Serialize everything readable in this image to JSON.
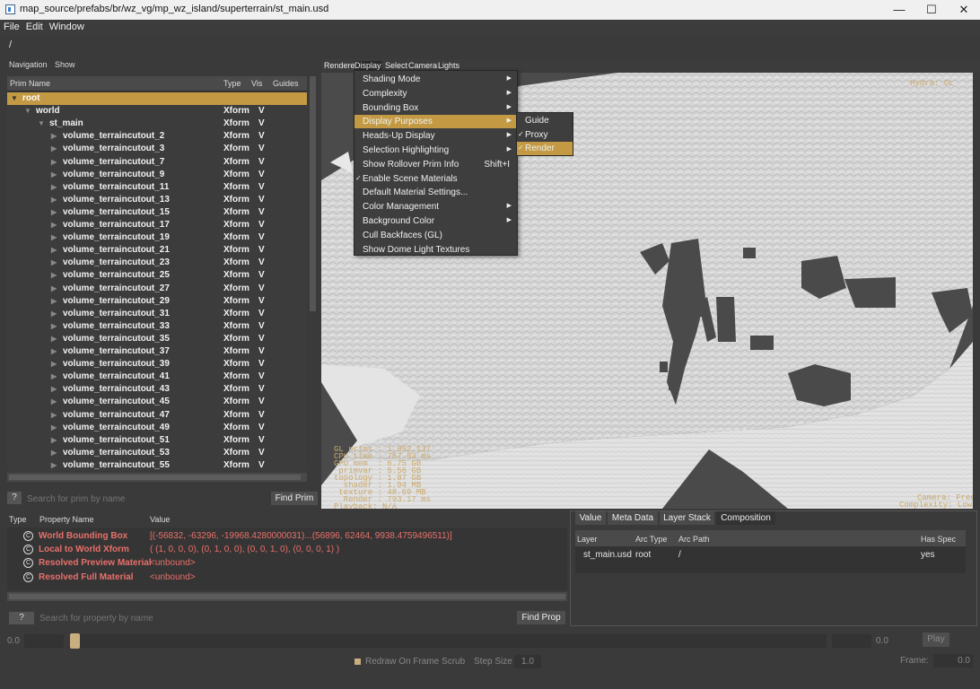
{
  "window": {
    "title": "map_source/prefabs/br/wz_vg/mp_wz_island/superterrain/st_main.usd",
    "minimize": "—",
    "maximize": "☐",
    "close": "✕"
  },
  "menubar": [
    "File",
    "Edit",
    "Window"
  ],
  "path": "/",
  "navigation": {
    "nav_label": "Navigation",
    "show_label": "Show"
  },
  "prim_tree": {
    "columns": {
      "name": "Prim Name",
      "type": "Type",
      "vis": "Vis",
      "guides": "Guides"
    },
    "rows": [
      {
        "name": "root",
        "type": "",
        "vis": "",
        "depth": 0,
        "expanded": true
      },
      {
        "name": "world",
        "type": "Xform",
        "vis": "V",
        "depth": 1,
        "expanded": true
      },
      {
        "name": "st_main",
        "type": "Xform",
        "vis": "V",
        "depth": 2,
        "expanded": true
      },
      {
        "name": "volume_terraincutout_2",
        "type": "Xform",
        "vis": "V",
        "depth": 3,
        "expanded": false
      },
      {
        "name": "volume_terraincutout_3",
        "type": "Xform",
        "vis": "V",
        "depth": 3,
        "expanded": false
      },
      {
        "name": "volume_terraincutout_7",
        "type": "Xform",
        "vis": "V",
        "depth": 3,
        "expanded": false
      },
      {
        "name": "volume_terraincutout_9",
        "type": "Xform",
        "vis": "V",
        "depth": 3,
        "expanded": false
      },
      {
        "name": "volume_terraincutout_11",
        "type": "Xform",
        "vis": "V",
        "depth": 3,
        "expanded": false
      },
      {
        "name": "volume_terraincutout_13",
        "type": "Xform",
        "vis": "V",
        "depth": 3,
        "expanded": false
      },
      {
        "name": "volume_terraincutout_15",
        "type": "Xform",
        "vis": "V",
        "depth": 3,
        "expanded": false
      },
      {
        "name": "volume_terraincutout_17",
        "type": "Xform",
        "vis": "V",
        "depth": 3,
        "expanded": false
      },
      {
        "name": "volume_terraincutout_19",
        "type": "Xform",
        "vis": "V",
        "depth": 3,
        "expanded": false
      },
      {
        "name": "volume_terraincutout_21",
        "type": "Xform",
        "vis": "V",
        "depth": 3,
        "expanded": false
      },
      {
        "name": "volume_terraincutout_23",
        "type": "Xform",
        "vis": "V",
        "depth": 3,
        "expanded": false
      },
      {
        "name": "volume_terraincutout_25",
        "type": "Xform",
        "vis": "V",
        "depth": 3,
        "expanded": false
      },
      {
        "name": "volume_terraincutout_27",
        "type": "Xform",
        "vis": "V",
        "depth": 3,
        "expanded": false
      },
      {
        "name": "volume_terraincutout_29",
        "type": "Xform",
        "vis": "V",
        "depth": 3,
        "expanded": false
      },
      {
        "name": "volume_terraincutout_31",
        "type": "Xform",
        "vis": "V",
        "depth": 3,
        "expanded": false
      },
      {
        "name": "volume_terraincutout_33",
        "type": "Xform",
        "vis": "V",
        "depth": 3,
        "expanded": false
      },
      {
        "name": "volume_terraincutout_35",
        "type": "Xform",
        "vis": "V",
        "depth": 3,
        "expanded": false
      },
      {
        "name": "volume_terraincutout_37",
        "type": "Xform",
        "vis": "V",
        "depth": 3,
        "expanded": false
      },
      {
        "name": "volume_terraincutout_39",
        "type": "Xform",
        "vis": "V",
        "depth": 3,
        "expanded": false
      },
      {
        "name": "volume_terraincutout_41",
        "type": "Xform",
        "vis": "V",
        "depth": 3,
        "expanded": false
      },
      {
        "name": "volume_terraincutout_43",
        "type": "Xform",
        "vis": "V",
        "depth": 3,
        "expanded": false
      },
      {
        "name": "volume_terraincutout_45",
        "type": "Xform",
        "vis": "V",
        "depth": 3,
        "expanded": false
      },
      {
        "name": "volume_terraincutout_47",
        "type": "Xform",
        "vis": "V",
        "depth": 3,
        "expanded": false
      },
      {
        "name": "volume_terraincutout_49",
        "type": "Xform",
        "vis": "V",
        "depth": 3,
        "expanded": false
      },
      {
        "name": "volume_terraincutout_51",
        "type": "Xform",
        "vis": "V",
        "depth": 3,
        "expanded": false
      },
      {
        "name": "volume_terraincutout_53",
        "type": "Xform",
        "vis": "V",
        "depth": 3,
        "expanded": false
      },
      {
        "name": "volume_terraincutout_55",
        "type": "Xform",
        "vis": "V",
        "depth": 3,
        "expanded": false
      }
    ]
  },
  "prim_search": {
    "help": "?",
    "placeholder": "Search for prim by name",
    "button": "Find Prim"
  },
  "viewport_menu": [
    "Renderer",
    "Display",
    "Select",
    "Camera",
    "Lights"
  ],
  "display_menu": {
    "items": [
      {
        "label": "Shading Mode",
        "submenu": true,
        "checked": false,
        "shortcut": ""
      },
      {
        "label": "Complexity",
        "submenu": true,
        "checked": false,
        "shortcut": ""
      },
      {
        "label": "Bounding Box",
        "submenu": true,
        "checked": false,
        "shortcut": ""
      },
      {
        "label": "Display Purposes",
        "submenu": true,
        "checked": false,
        "shortcut": ""
      },
      {
        "label": "Heads-Up Display",
        "submenu": true,
        "checked": false,
        "shortcut": ""
      },
      {
        "label": "Selection Highlighting",
        "submenu": true,
        "checked": false,
        "shortcut": ""
      },
      {
        "label": "Show Rollover Prim Info",
        "submenu": false,
        "checked": false,
        "shortcut": "Shift+I"
      },
      {
        "label": "Enable Scene Materials",
        "submenu": false,
        "checked": true,
        "shortcut": ""
      },
      {
        "label": "Default Material Settings...",
        "submenu": false,
        "checked": false,
        "shortcut": ""
      },
      {
        "label": "Color Management",
        "submenu": true,
        "checked": false,
        "shortcut": ""
      },
      {
        "label": "Background Color",
        "submenu": true,
        "checked": false,
        "shortcut": ""
      },
      {
        "label": "Cull Backfaces (GL)",
        "submenu": false,
        "checked": false,
        "shortcut": ""
      },
      {
        "label": "Show Dome Light Textures",
        "submenu": false,
        "checked": false,
        "shortcut": ""
      }
    ],
    "highlighted": "Display Purposes"
  },
  "purposes_submenu": [
    {
      "label": "Guide",
      "checked": false
    },
    {
      "label": "Proxy",
      "checked": true
    },
    {
      "label": "Render",
      "checked": true
    }
  ],
  "hud": {
    "stats": "GL prims : 1,892,137\nCPU time : 787.93 ms\nGPU mem  : 6.75 GB\n primvar : 5.56 GB\ntopology : 1.87 GB\n  shader : 1.94 MB\n texture : 48.69 MB\n  Render : 793.17 ms\nPlayback: N/A",
    "renderer": "Hydra: GL",
    "camera": "Camera: Free",
    "complexity": "Complexity: Low"
  },
  "properties": {
    "columns": {
      "type": "Type",
      "name": "Property Name",
      "value": "Value"
    },
    "rows": [
      {
        "icon": "C",
        "name": "World Bounding Box",
        "value": "[(-56832, -63296, -19968.4280000031)...(56896, 62464, 9938.4759496511)]"
      },
      {
        "icon": "C",
        "name": "Local to World Xform",
        "value": "( (1, 0, 0, 0), (0, 1, 0, 0), (0, 0, 1, 0), (0, 0, 0, 1) )"
      },
      {
        "icon": "C",
        "name": "Resolved Preview Material",
        "value": "<unbound>"
      },
      {
        "icon": "C",
        "name": "Resolved Full Material",
        "value": "<unbound>"
      }
    ]
  },
  "prop_search": {
    "help": "?",
    "placeholder": "Search for property by name",
    "button": "Find Prop"
  },
  "composition": {
    "tabs": [
      "Value",
      "Meta Data",
      "Layer Stack",
      "Composition"
    ],
    "active_tab": "Composition",
    "columns": {
      "layer": "Layer",
      "arc_type": "Arc Type",
      "arc_path": "Arc Path",
      "has_spec": "Has Spec"
    },
    "rows": [
      {
        "layer": "st_main.usd",
        "arc_type": "root",
        "arc_path": "/",
        "has_spec": "yes"
      }
    ]
  },
  "timeline": {
    "start": "0.0",
    "end": "0.0",
    "play": "Play",
    "redraw_label": "Redraw On Frame Scrub",
    "step_label": "Step Size",
    "step_value": "1.0",
    "frame_label": "Frame:",
    "frame_value": "0.0"
  },
  "colors": {
    "accent": "#c39a43",
    "property_text": "#e8706a",
    "hud_text": "#c9a86a"
  }
}
